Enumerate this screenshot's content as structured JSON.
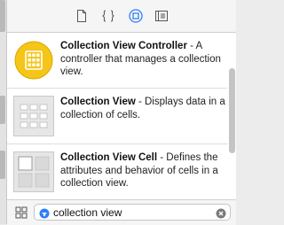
{
  "tabs": [
    {
      "icon": "file-icon",
      "selected": false
    },
    {
      "icon": "braces-icon",
      "selected": false
    },
    {
      "icon": "object-library-icon",
      "selected": true
    },
    {
      "icon": "media-library-icon",
      "selected": false
    }
  ],
  "library": {
    "items": [
      {
        "icon": "collection-view-controller-icon",
        "title": "Collection View Controller",
        "description": " - A controller that manages a collection view."
      },
      {
        "icon": "collection-view-icon",
        "title": "Collection View",
        "description": " - Displays data in a collection of cells."
      },
      {
        "icon": "collection-view-cell-icon",
        "title": "Collection View Cell",
        "description": " - Defines the attributes and behavior of cells in a collection view."
      }
    ]
  },
  "footer": {
    "grid_toggle_icon": "grid-view-icon",
    "search": {
      "value": "collection view",
      "filter_icon": "filter-icon",
      "clear_icon": "clear-search-icon"
    }
  },
  "colors": {
    "accent": "#2f7ff7",
    "controller_yellow": "#f5c518",
    "panel_bg": "#f5f5f5"
  }
}
